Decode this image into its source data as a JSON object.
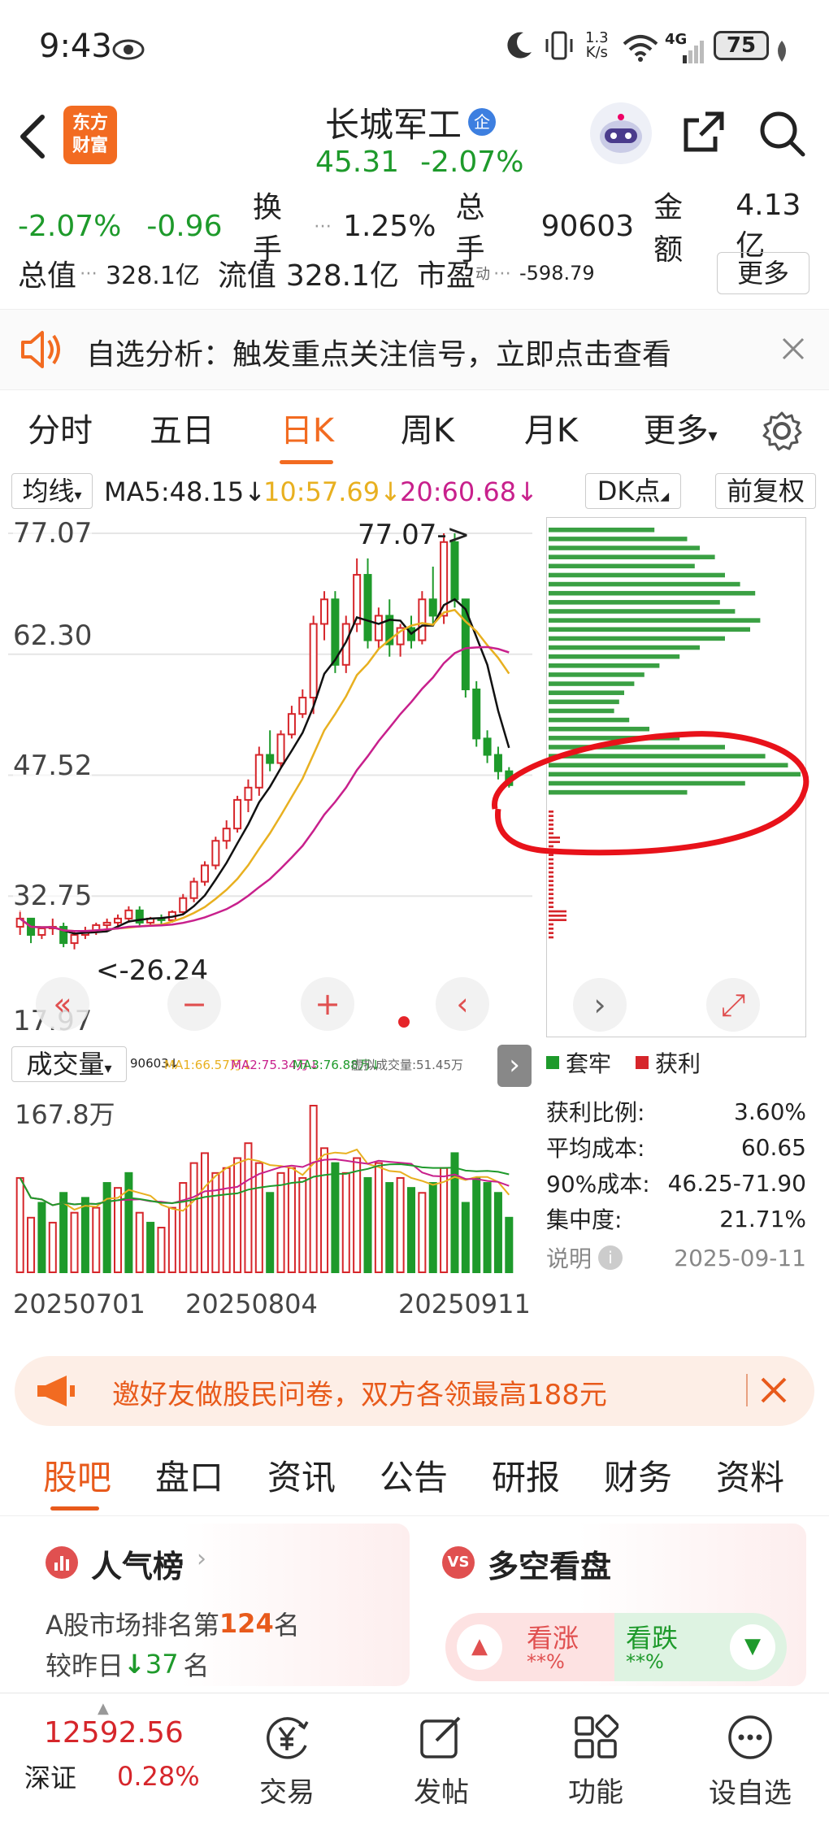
{
  "status": {
    "time": "9:43",
    "speed_value": "1.3",
    "speed_unit": "K/s",
    "network": "4G",
    "battery": "75"
  },
  "header": {
    "logo_line1": "东方",
    "logo_line2": "财富",
    "stock_name": "长城军工",
    "badge": "企",
    "price": "45.31",
    "change_pct": "-2.07%"
  },
  "quote": {
    "change_pct": "-2.07%",
    "change_amt": "-0.96",
    "turnover_label": "换手",
    "turnover_value": "1.25%",
    "volume_label": "总手",
    "volume_value": "90603",
    "amount_label": "金额",
    "amount_value": "4.13亿",
    "mktcap_label": "总值",
    "mktcap_value": "328.1亿",
    "float_label": "流值",
    "float_value": "328.1亿",
    "pe_label": "市盈",
    "pe_sup": "动",
    "pe_value": "-598.79",
    "more_button": "更多"
  },
  "notice": {
    "text": "自选分析：触发重点关注信号，立即点击查看"
  },
  "period_tabs": [
    "分时",
    "五日",
    "日K",
    "周K",
    "月K",
    "更多"
  ],
  "period_active": 2,
  "ma": {
    "selector": "均线",
    "ma5": "MA5:48.15",
    "ma10": "10:57.69",
    "ma20": "20:60.68",
    "dk_button": "DK点",
    "fq_button": "前复权"
  },
  "chart_data": {
    "type": "candlestick",
    "y_ticks": [
      "77.07",
      "62.30",
      "47.52",
      "32.75",
      "17.97"
    ],
    "ylim": [
      17.97,
      77.07
    ],
    "high_annotation": "77.07->",
    "low_annotation": "<-26.24",
    "x_ticks": [
      "20250701",
      "20250804",
      "20250911"
    ],
    "volume_max_label": "167.8万",
    "colors": {
      "up": "#d6262b",
      "down": "#1e9a2b",
      "ma5": "#111111",
      "ma10": "#e8b020",
      "ma20": "#c8208c"
    },
    "candles": [
      [
        29,
        31,
        28,
        30
      ],
      [
        30,
        30,
        27,
        28
      ],
      [
        28,
        29,
        27.5,
        28.8
      ],
      [
        28.8,
        30,
        28,
        29
      ],
      [
        29,
        29.5,
        26.5,
        27
      ],
      [
        27,
        28.5,
        26.24,
        28
      ],
      [
        28,
        29,
        27.5,
        28.5
      ],
      [
        28.5,
        29.5,
        28,
        29.2
      ],
      [
        29.2,
        30,
        28.6,
        29.5
      ],
      [
        29.5,
        30.5,
        29,
        30
      ],
      [
        30,
        31.5,
        29.5,
        31
      ],
      [
        31,
        31.5,
        29,
        29.5
      ],
      [
        29.5,
        30.2,
        29,
        30
      ],
      [
        30,
        30.5,
        29.2,
        29.8
      ],
      [
        29.8,
        31,
        29.5,
        30.8
      ],
      [
        30.8,
        33,
        30.5,
        32.5
      ],
      [
        32.5,
        35,
        32,
        34.5
      ],
      [
        34.5,
        37,
        34,
        36.5
      ],
      [
        36.5,
        40,
        36,
        39.5
      ],
      [
        39.5,
        42,
        38.5,
        41
      ],
      [
        41,
        45,
        40.5,
        44.5
      ],
      [
        44.5,
        47,
        43,
        46
      ],
      [
        46,
        51,
        45,
        50
      ],
      [
        50,
        53,
        48,
        49
      ],
      [
        49,
        53,
        48.5,
        52.5
      ],
      [
        52.5,
        56,
        52,
        55
      ],
      [
        55,
        58,
        54.5,
        57
      ],
      [
        57,
        67,
        55,
        66
      ],
      [
        66,
        70,
        64,
        69
      ],
      [
        69,
        70,
        60,
        61
      ],
      [
        61,
        67,
        60,
        66
      ],
      [
        66,
        74,
        65,
        72
      ],
      [
        72,
        74,
        63,
        64
      ],
      [
        64,
        68,
        63,
        67
      ],
      [
        67,
        69,
        62,
        63.5
      ],
      [
        63.5,
        66,
        62,
        65.5
      ],
      [
        65.5,
        67,
        63,
        64
      ],
      [
        64,
        70,
        63.5,
        69
      ],
      [
        69,
        73,
        66,
        67
      ],
      [
        67,
        77.07,
        66,
        76
      ],
      [
        76,
        77.07,
        68,
        69
      ],
      [
        69,
        69,
        57,
        58
      ],
      [
        58,
        59,
        51,
        52
      ],
      [
        52,
        53,
        49,
        50
      ],
      [
        50,
        51,
        47,
        48
      ],
      [
        48,
        48.5,
        46,
        46.3
      ]
    ],
    "volume": [
      [
        1,
        95
      ],
      [
        1,
        55
      ],
      [
        -1,
        70
      ],
      [
        1,
        50
      ],
      [
        -1,
        80
      ],
      [
        1,
        60
      ],
      [
        -1,
        75
      ],
      [
        1,
        65
      ],
      [
        -1,
        90
      ],
      [
        1,
        85
      ],
      [
        -1,
        100
      ],
      [
        1,
        60
      ],
      [
        -1,
        50
      ],
      [
        1,
        45
      ],
      [
        1,
        65
      ],
      [
        1,
        90
      ],
      [
        1,
        110
      ],
      [
        1,
        120
      ],
      [
        1,
        100
      ],
      [
        1,
        105
      ],
      [
        1,
        115
      ],
      [
        1,
        130
      ],
      [
        1,
        110
      ],
      [
        -1,
        80
      ],
      [
        1,
        100
      ],
      [
        1,
        105
      ],
      [
        1,
        95
      ],
      [
        1,
        167.8
      ],
      [
        1,
        125
      ],
      [
        -1,
        110
      ],
      [
        1,
        100
      ],
      [
        1,
        115
      ],
      [
        -1,
        95
      ],
      [
        1,
        110
      ],
      [
        -1,
        90
      ],
      [
        1,
        95
      ],
      [
        -1,
        85
      ],
      [
        1,
        80
      ],
      [
        -1,
        90
      ],
      [
        1,
        105
      ],
      [
        -1,
        120
      ],
      [
        -1,
        70
      ],
      [
        -1,
        95
      ],
      [
        -1,
        90
      ],
      [
        -1,
        80
      ],
      [
        -1,
        55
      ]
    ],
    "ma_vol": {
      "mode": "auto"
    },
    "chip_green": [
      0.42,
      0.55,
      0.6,
      0.66,
      0.58,
      0.7,
      0.76,
      0.82,
      0.68,
      0.74,
      0.84,
      0.8,
      0.7,
      0.6,
      0.52,
      0.44,
      0.38,
      0.34,
      0.3,
      0.28,
      0.26,
      0.32,
      0.4,
      0.52,
      0.7,
      0.86,
      0.95,
      1.0,
      0.78,
      0.55
    ],
    "chip_red_note": "获利"
  },
  "volume_row": {
    "label": "成交量",
    "v1": "90603↓",
    "v2": "MA1:66.57万↓",
    "v3": "MA2:75.34万↓",
    "v4": "MA3:76.88万↓",
    "v5": "虚拟成交量:51.45万"
  },
  "chip": {
    "legend_green": "套牢",
    "legend_red": "获利",
    "rows": [
      {
        "label": "获利比例:",
        "value": "3.60%"
      },
      {
        "label": "平均成本:",
        "value": "60.65"
      },
      {
        "label": "90%成本:",
        "value": "46.25-71.90"
      },
      {
        "label": "集中度:",
        "value": "21.71%"
      }
    ],
    "note_label": "说明",
    "note_date": "2025-09-11"
  },
  "promo": {
    "text": "邀好友做股民问卷，双方各领最高188元"
  },
  "bottom_tabs": [
    "股吧",
    "盘口",
    "资讯",
    "公告",
    "研报",
    "财务",
    "资料"
  ],
  "bottom_active": 0,
  "cards": {
    "popularity_title": "人气榜",
    "rank_prefix": "A股市场排名第",
    "rank_value": "124",
    "rank_suffix": "名",
    "change_prefix": "较昨日",
    "change_value": "37",
    "change_suffix": "名",
    "vs_title": "多空看盘",
    "bull_label": "看涨",
    "bull_value": "**%",
    "bear_label": "看跌",
    "bear_value": "**%"
  },
  "navbar": {
    "index_value": "12592.56",
    "index_name": "深证",
    "index_change": "0.28%",
    "items": [
      "交易",
      "发帖",
      "功能",
      "设自选"
    ]
  }
}
